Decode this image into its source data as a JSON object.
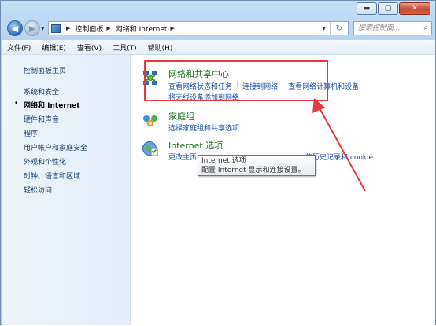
{
  "window": {
    "controls": {
      "minimize": "▬",
      "maximize": "▢",
      "close": "✕"
    }
  },
  "address": {
    "breadcrumbs": [
      "控制面板",
      "网络和 Internet"
    ],
    "search_placeholder": "搜索控制面..."
  },
  "menu": [
    "文件(F)",
    "编辑(E)",
    "查看(V)",
    "工具(T)",
    "帮助(H)"
  ],
  "sidebar": {
    "items": [
      "控制面板主页",
      "系统和安全",
      "网络和 Internet",
      "硬件和声音",
      "程序",
      "用户帐户和家庭安全",
      "外观和个性化",
      "时钟、语言和区域",
      "轻松访问"
    ],
    "active_index": 2
  },
  "categories": [
    {
      "title": "网络和共享中心",
      "links": [
        "查看网络状态和任务",
        "连接到网络",
        "查看网络计算机和设备"
      ],
      "links2": [
        "将无线设备添加到网络"
      ],
      "icon": "network-center-icon"
    },
    {
      "title": "家庭组",
      "links": [
        "选择家庭组和共享选项"
      ],
      "icon": "homegroup-icon"
    },
    {
      "title": "Internet 选项",
      "links": [
        "更改主页",
        "的历史记录和 cookie"
      ],
      "icon": "internet-options-icon"
    }
  ],
  "tooltip": {
    "line1": "Internet 选项",
    "line2": "配置 Internet 显示和连接设置。"
  },
  "colors": {
    "annotation": "#e8383a",
    "link": "#1d4fa6",
    "category_title": "#1e6f1e"
  }
}
